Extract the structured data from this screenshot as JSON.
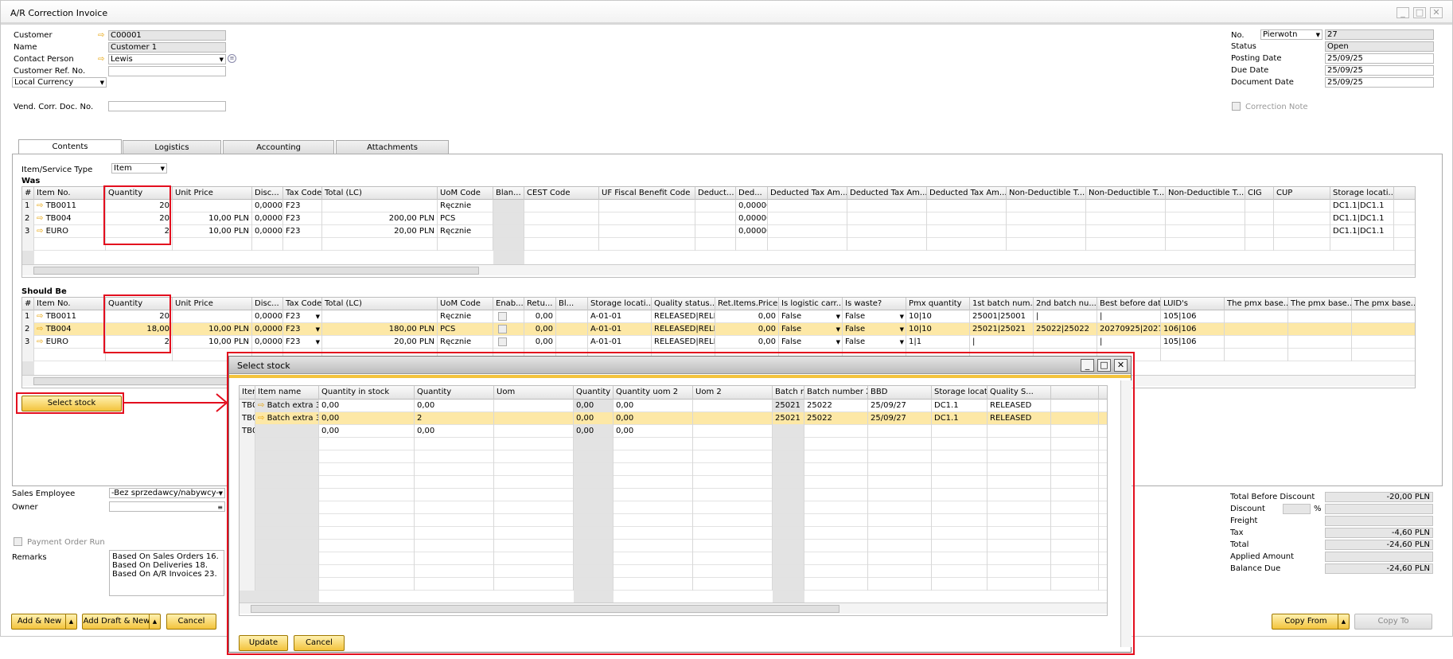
{
  "window": {
    "title": "A/R Correction Invoice"
  },
  "header": {
    "customer_label": "Customer",
    "customer_value": "C00001",
    "name_label": "Name",
    "name_value": "Customer 1",
    "contact_label": "Contact Person",
    "contact_value": "Lewis",
    "custref_label": "Customer Ref. No.",
    "custref_value": "",
    "currency_value": "Local Currency",
    "vendcorr_label": "Vend. Corr. Doc. No.",
    "vendcorr_value": "",
    "no_label": "No.",
    "no_series": "Pierwotn",
    "no_value": "27",
    "status_label": "Status",
    "status_value": "Open",
    "posting_label": "Posting Date",
    "posting_value": "25/09/25",
    "due_label": "Due Date",
    "due_value": "25/09/25",
    "docdate_label": "Document Date",
    "docdate_value": "25/09/25",
    "correction_note_label": "Correction Note"
  },
  "tabs": [
    "Contents",
    "Logistics",
    "Accounting",
    "Attachments"
  ],
  "contents": {
    "type_label": "Item/Service Type",
    "type_value": "Item",
    "was_label": "Was",
    "should_label": "Should Be"
  },
  "was_grid": {
    "columns": [
      "#",
      "Item No.",
      "Quantity",
      "Unit Price",
      "Disc...",
      "Tax Code",
      "Total (LC)",
      "UoM Code",
      "Blan...",
      "CEST Code",
      "UF Fiscal Benefit Code",
      "Deduct...",
      "Ded...",
      "Deducted Tax Am...",
      "Deducted Tax Am...",
      "Deducted Tax Am...",
      "Non-Deductible T...",
      "Non-Deductible T...",
      "Non-Deductible T...",
      "CIG",
      "CUP",
      "Storage locati..."
    ],
    "rows": [
      [
        "1",
        "TB0011",
        "20",
        "",
        "0,0000",
        "F23",
        "",
        "Ręcznie",
        "",
        "",
        "",
        "",
        "0,000000",
        "",
        "",
        "",
        "",
        "",
        "",
        "",
        "",
        "DC1.1|DC1.1"
      ],
      [
        "2",
        "TB004",
        "20",
        "10,00 PLN",
        "0,0000",
        "F23",
        "200,00 PLN",
        "PCS",
        "",
        "",
        "",
        "",
        "0,000000",
        "",
        "",
        "",
        "",
        "",
        "",
        "",
        "",
        "DC1.1|DC1.1"
      ],
      [
        "3",
        "EURO",
        "2",
        "10,00 PLN",
        "0,0000",
        "F23",
        "20,00 PLN",
        "Ręcznie",
        "",
        "",
        "",
        "",
        "0,000000",
        "",
        "",
        "",
        "",
        "",
        "",
        "",
        "",
        "DC1.1|DC1.1"
      ]
    ]
  },
  "should_grid": {
    "columns": [
      "#",
      "Item No.",
      "Quantity",
      "Unit Price",
      "Disc...",
      "Tax Code",
      "Total (LC)",
      "UoM Code",
      "Enab...",
      "Retu...",
      "Bl...",
      "Storage locati...",
      "Quality status...",
      "Ret.Items.Price",
      "Is logistic carr...",
      "Is waste?",
      "Pmx quantity",
      "1st batch num...",
      "2nd batch nu...",
      "Best before date",
      "LUID's",
      "The pmx base...",
      "The pmx base...",
      "The pmx base..."
    ],
    "rows": [
      [
        "1",
        "TB0011",
        "20",
        "",
        "0,0000",
        "F23",
        "",
        "Ręcznie",
        "",
        "0,00",
        "",
        "A-01-01",
        "RELEASED|RELE",
        "0,00",
        "False",
        "False",
        "10|10",
        "25001|25001",
        "|",
        "|",
        "105|106",
        "",
        "",
        ""
      ],
      [
        "2",
        "TB004",
        "18,00",
        "10,00 PLN",
        "0,0000",
        "F23",
        "180,00 PLN",
        "PCS",
        "",
        "0,00",
        "",
        "A-01-01",
        "RELEASED|RELE",
        "0,00",
        "False",
        "False",
        "10|10",
        "25021|25021",
        "25022|25022",
        "20270925|2027092",
        "106|106",
        "",
        "",
        ""
      ],
      [
        "3",
        "EURO",
        "2",
        "10,00 PLN",
        "0,0000",
        "F23",
        "20,00 PLN",
        "Ręcznie",
        "",
        "0,00",
        "",
        "A-01-01",
        "RELEASED|RELE",
        "0,00",
        "False",
        "False",
        "1|1",
        "|",
        "",
        "|",
        "105|106",
        "",
        "",
        ""
      ]
    ]
  },
  "select_stock_button": "Select stock",
  "footer": {
    "sales_emp_label": "Sales Employee",
    "sales_emp_value": "-Bez sprzedawcy/nabywcy-",
    "owner_label": "Owner",
    "owner_value": "",
    "payment_order_label": "Payment Order Run",
    "remarks_label": "Remarks",
    "remarks_value": "Based On Sales Orders 16. Based On Deliveries 18. Based On A/R Invoices 23.",
    "add_new": "Add & New",
    "add_draft": "Add Draft & New",
    "cancel": "Cancel",
    "copy_from": "Copy From",
    "copy_to": "Copy To"
  },
  "totals": {
    "before_discount_label": "Total Before Discount",
    "before_discount_value": "-20,00 PLN",
    "discount_label": "Discount",
    "discount_pct": "",
    "discount_symbol": "%",
    "discount_value": "",
    "freight_label": "Freight",
    "freight_value": "",
    "tax_label": "Tax",
    "tax_value": "-4,60 PLN",
    "total_label": "Total",
    "total_value": "-24,60 PLN",
    "applied_label": "Applied Amount",
    "applied_value": "",
    "balance_label": "Balance Due",
    "balance_value": "-24,60 PLN"
  },
  "dialog": {
    "title": "Select stock",
    "columns": [
      "Item code",
      "Item name",
      "Quantity in stock",
      "Quantity",
      "Uom",
      "Quantity uom2 in ...",
      "Quantity uom 2",
      "Uom 2",
      "Batch number",
      "Batch number 2",
      "BBD",
      "Storage location",
      "Quality S..."
    ],
    "rows": [
      [
        "TB004",
        "Batch extra 3",
        "0,00",
        "0,00",
        "",
        "0,00",
        "0,00",
        "",
        "25021",
        "25022",
        "25/09/27",
        "DC1.1",
        "RELEASED"
      ],
      [
        "TB004",
        "Batch extra 3",
        "0,00",
        "2",
        "",
        "0,00",
        "0,00",
        "",
        "25021",
        "25022",
        "25/09/27",
        "DC1.1",
        "RELEASED"
      ],
      [
        "TB004",
        "",
        "0,00",
        "0,00",
        "",
        "0,00",
        "0,00",
        "",
        "",
        "",
        "",
        "",
        ""
      ]
    ],
    "update": "Update",
    "cancel": "Cancel"
  },
  "colors": {
    "accent": "#f3c33c",
    "highlight": "#e30e1e",
    "selected_row": "#fde8a6"
  }
}
